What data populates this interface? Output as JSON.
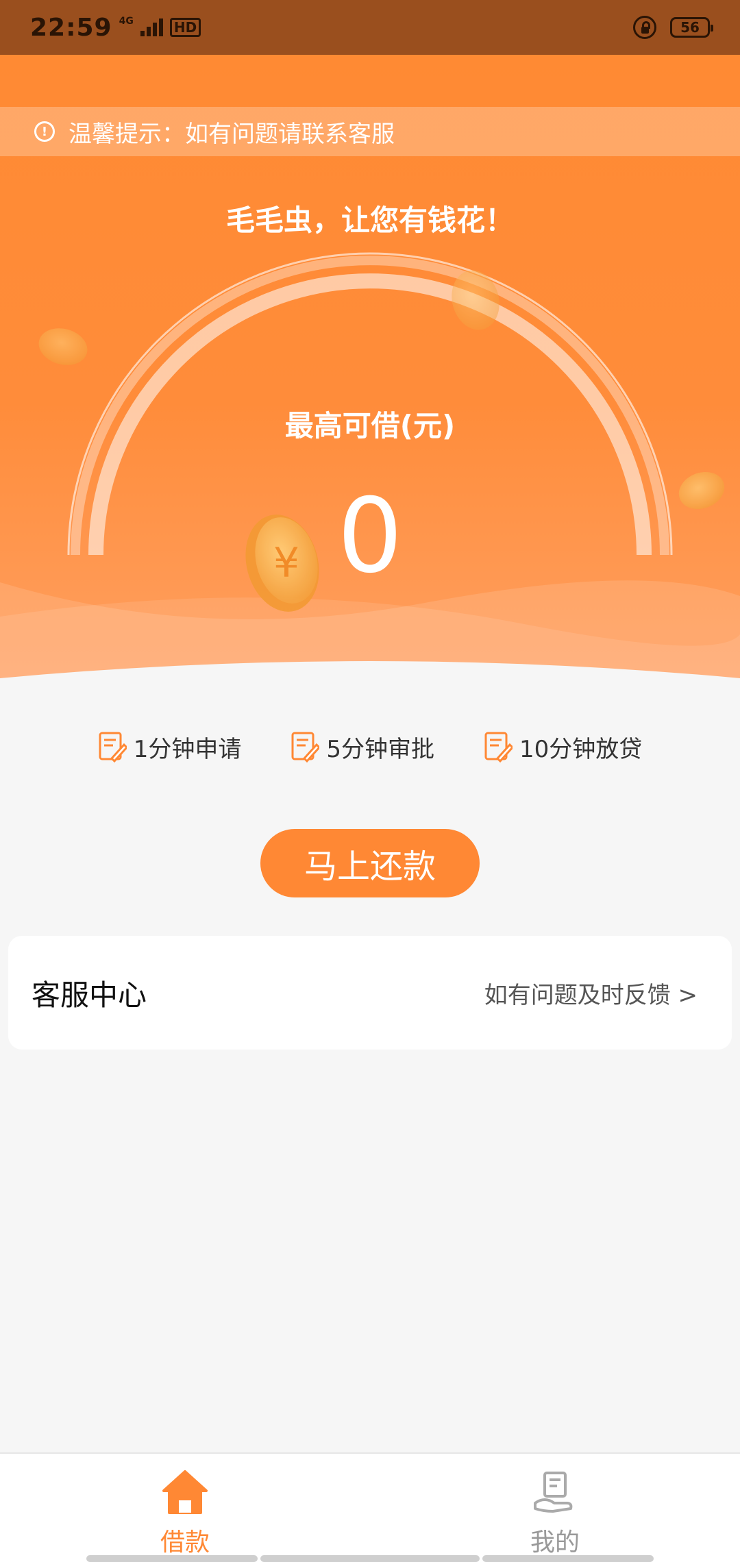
{
  "status_bar": {
    "time": "22:59",
    "network": "4G",
    "hd": "HD",
    "battery": "56"
  },
  "notice": {
    "text": "温馨提示：如有问题请联系客服"
  },
  "hero": {
    "slogan": "毛毛虫，让您有钱花！",
    "limit_label": "最高可借(元)",
    "limit_value": "0"
  },
  "features": [
    {
      "label": "1分钟申请",
      "icon": "edit-note-icon"
    },
    {
      "label": "5分钟审批",
      "icon": "edit-note-icon"
    },
    {
      "label": "10分钟放贷",
      "icon": "edit-note-icon"
    }
  ],
  "repay_button": {
    "label": "马上还款"
  },
  "service": {
    "title": "客服中心",
    "link": "如有问题及时反馈 >"
  },
  "bottom_nav": {
    "items": [
      {
        "label": "借款",
        "icon": "home-icon",
        "active": true
      },
      {
        "label": "我的",
        "icon": "profile-hand-icon",
        "active": false
      }
    ]
  },
  "colors": {
    "primary": "#ff8834",
    "status_bar": "#9a4f1e",
    "background": "#f6f6f6"
  }
}
